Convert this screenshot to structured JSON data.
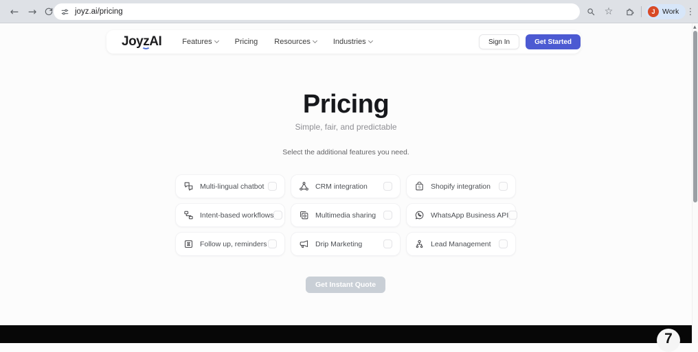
{
  "browser": {
    "url": "joyz.ai/pricing",
    "back_icon": "←",
    "forward_icon": "→",
    "bookmark_icon": "☆",
    "menu_icon": "⋮",
    "scroll_up_arrow": "▲",
    "profile": {
      "initial": "J",
      "label": "Work"
    }
  },
  "nav": {
    "logo": {
      "prefix": "Joy",
      "accent_letter": "z",
      "suffix": "AI"
    },
    "items": [
      {
        "label": "Features",
        "dropdown": true
      },
      {
        "label": "Pricing",
        "dropdown": false
      },
      {
        "label": "Resources",
        "dropdown": true
      },
      {
        "label": "Industries",
        "dropdown": true
      }
    ],
    "sign_in_label": "Sign In",
    "get_started_label": "Get Started"
  },
  "hero": {
    "title": "Pricing",
    "subtitle": "Simple, fair, and predictable",
    "instruction": "Select the additional features you need."
  },
  "features": {
    "items": [
      {
        "label": "Multi-lingual chatbot",
        "icon": "translate-chat-icon",
        "checked": false
      },
      {
        "label": "CRM integration",
        "icon": "network-nodes-icon",
        "checked": false
      },
      {
        "label": "Shopify integration",
        "icon": "shopping-bag-icon",
        "checked": false
      },
      {
        "label": "Intent-based workflows",
        "icon": "workflow-icon",
        "checked": false
      },
      {
        "label": "Multimedia sharing",
        "icon": "media-stack-icon",
        "checked": false
      },
      {
        "label": "WhatsApp Business API",
        "icon": "whatsapp-icon",
        "checked": false
      },
      {
        "label": "Follow up, reminders",
        "icon": "reminder-box-icon",
        "checked": false
      },
      {
        "label": "Drip Marketing",
        "icon": "megaphone-icon",
        "checked": false
      },
      {
        "label": "Lead Management",
        "icon": "lead-person-icon",
        "checked": false
      }
    ]
  },
  "cta": {
    "label": "Get Instant Quote",
    "disabled": true
  },
  "footer": {
    "badge": "7"
  },
  "colors": {
    "accent": "#4c5ad2",
    "toolbar_bg": "#dee1e6",
    "disabled_button_bg": "#c9cfd6",
    "footer_bg": "#070707",
    "avatar_bg": "#d84a27",
    "profile_chip_bg": "#d7e6f9"
  }
}
